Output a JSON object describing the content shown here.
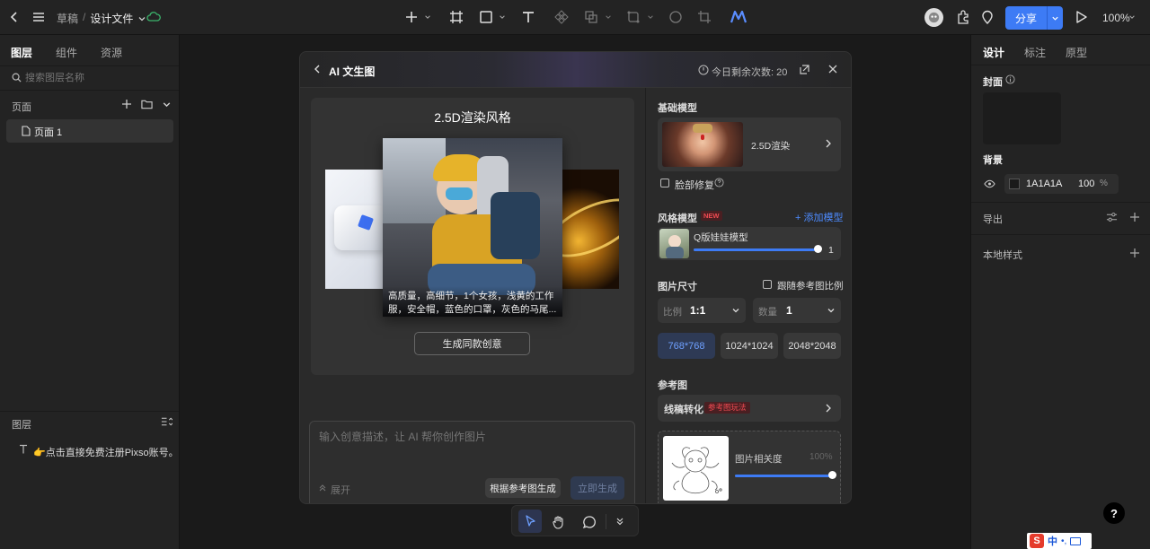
{
  "breadcrumb": {
    "parent": "草稿",
    "separator": "/",
    "file": "设计文件"
  },
  "topbar": {
    "share_label": "分享",
    "zoom": "100%"
  },
  "left": {
    "tabs": [
      "图层",
      "组件",
      "资源"
    ],
    "search_placeholder": "搜索图层名称",
    "pages_label": "页面",
    "page_item": "页面 1",
    "layers_label": "图层",
    "layer_text": "👉点击直接免费注册Pixso账号。"
  },
  "right": {
    "tabs": [
      "设计",
      "标注",
      "原型"
    ],
    "cover_label": "封面",
    "background_label": "背景",
    "bg_hex": "1A1A1A",
    "bg_opacity": "100",
    "bg_unit": "%",
    "export_label": "导出",
    "local_style_label": "本地样式"
  },
  "modal": {
    "title": "AI 文生图",
    "remaining": "今日剩余次数: 20",
    "preview_title": "2.5D渲染风格",
    "preview_caption": "高质量，高细节，1个女孩，浅黄的工作服，安全帽，蓝色的口罩，灰色的马尾...",
    "same_idea_btn": "生成同款创意",
    "prompt_placeholder": "输入创意描述，让 AI 帮你创作图片",
    "expand_label": "展开",
    "ref_generate_btn": "根据参考图生成",
    "generate_btn": "立即生成",
    "base_model_label": "基础模型",
    "base_model_name": "2.5D渲染",
    "face_fix_label": "脸部修复",
    "style_model_label": "风格模型",
    "new_badge": "NEW",
    "add_model_label": "+ 添加模型",
    "style_model_name": "Q版娃娃模型",
    "style_model_value": "1",
    "style_model_level": 1.0,
    "size_label": "图片尺寸",
    "follow_ratio_label": "跟随参考图比例",
    "ratio_label": "比例",
    "ratio_value": "1:1",
    "count_label": "数量",
    "count_value": "1",
    "sizes": [
      "768*768",
      "1024*1024",
      "2048*2048"
    ],
    "ref_label": "参考图",
    "ref_mode": "线稿转化",
    "ref_badge": "参考图玩法",
    "similarity_label": "图片相关度",
    "similarity_value": "100%",
    "similarity_level": 1.0
  },
  "colors": {
    "accent": "#3d7bf5",
    "new_badge": "#e0343b",
    "panel": "#232323",
    "canvas": "#1a1a1a"
  },
  "bottom_toolbar": [
    "move-tool",
    "hand-tool",
    "comment-tool",
    "more"
  ],
  "ime": {
    "label": "中"
  }
}
